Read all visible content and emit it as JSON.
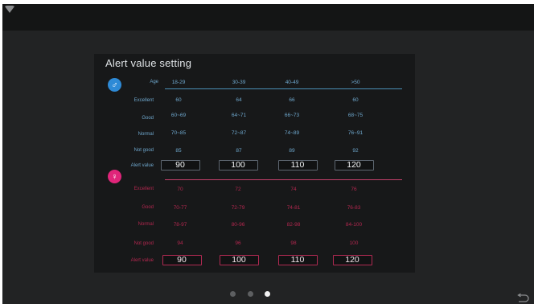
{
  "panel": {
    "title": "Alert value setting"
  },
  "icons": {
    "male": "male-symbol-icon",
    "female": "female-symbol-icon",
    "status": "wifi-icon",
    "back": "back-arrow-icon"
  },
  "colors": {
    "male_accent": "#2e8ad6",
    "female_accent": "#e0257a"
  },
  "male": {
    "header_label": "Age",
    "ages": [
      "18-29",
      "30-39",
      "40-49",
      ">50"
    ],
    "rows": [
      {
        "label": "Excellent",
        "values": [
          "60",
          "64",
          "66",
          "60"
        ]
      },
      {
        "label": "Good",
        "values": [
          "60~69",
          "64~71",
          "66~73",
          "68~75"
        ]
      },
      {
        "label": "Normal",
        "values": [
          "70~85",
          "72~87",
          "74~89",
          "76~91"
        ]
      },
      {
        "label": "Not good",
        "values": [
          "85",
          "87",
          "89",
          "92"
        ]
      }
    ],
    "alert_label": "Alert value",
    "alert_values": [
      "90",
      "100",
      "110",
      "120"
    ]
  },
  "female": {
    "rows": [
      {
        "label": "Excellent",
        "values": [
          "70",
          "72",
          "74",
          "76"
        ]
      },
      {
        "label": "Good",
        "values": [
          "70-77",
          "72-79",
          "74-81",
          "76-83"
        ]
      },
      {
        "label": "Normal",
        "values": [
          "78-97",
          "80-96",
          "82-98",
          "84-100"
        ]
      },
      {
        "label": "Not good",
        "values": [
          "94",
          "96",
          "98",
          "100"
        ]
      }
    ],
    "alert_label": "Alert value",
    "alert_values": [
      "90",
      "100",
      "110",
      "120"
    ]
  },
  "pager": {
    "count": 3,
    "active": 3
  }
}
